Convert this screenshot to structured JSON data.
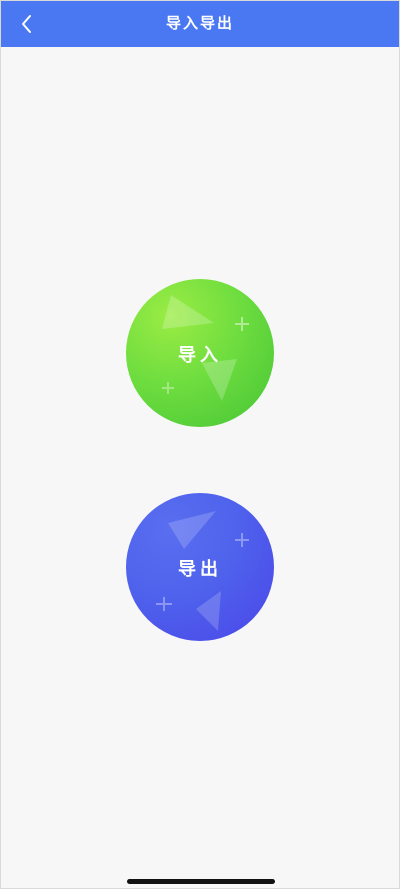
{
  "header": {
    "title": "导入导出",
    "back_icon": "chevron-left-icon"
  },
  "actions": {
    "import_label": "导入",
    "export_label": "导出"
  },
  "colors": {
    "header_bg": "#4a78f2",
    "import_green": "#6fdd3f",
    "export_blue": "#4e62ec",
    "page_bg": "#f7f7f8"
  }
}
